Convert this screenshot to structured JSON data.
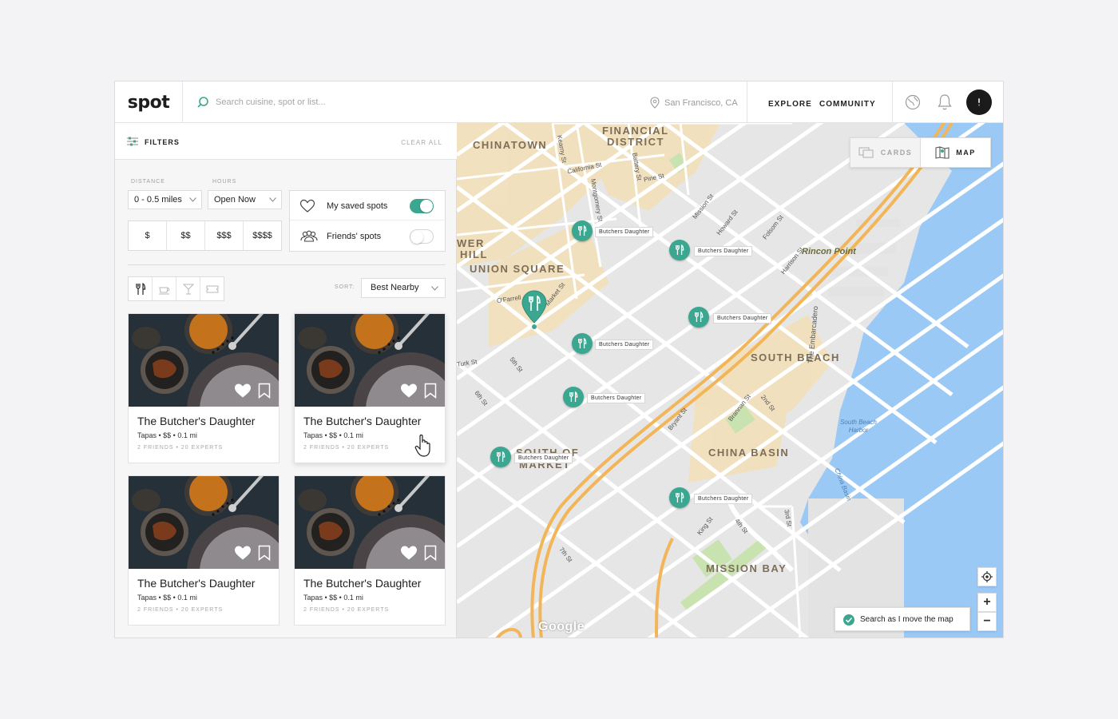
{
  "app": {
    "logo": "spot"
  },
  "header": {
    "search_placeholder": "Search cuisine, spot or list...",
    "location": "San Francisco, CA",
    "nav": [
      "EXPLORE",
      "COMMUNITY"
    ]
  },
  "filters": {
    "title": "FILTERS",
    "clear_all": "CLEAR ALL",
    "distance_label": "DISTANCE",
    "distance_value": "0 - 0.5 miles",
    "hours_label": "HOURS",
    "hours_value": "Open Now",
    "prices": [
      "$",
      "$$",
      "$$$",
      "$$$$"
    ],
    "saved_spots": {
      "label": "My saved spots",
      "on": true
    },
    "friends_spots": {
      "label": "Friends' spots",
      "on": false
    },
    "categories": [
      "restaurant-icon",
      "coffee-icon",
      "bar-icon",
      "ticket-icon"
    ],
    "sort_label": "SORT:",
    "sort_value": "Best Nearby"
  },
  "cards": [
    {
      "title": "The Butcher's Daughter",
      "meta": "Tapas • $$  • 0.1 mi",
      "social": "2 FRIENDS • 20 EXPERTS"
    },
    {
      "title": "The Butcher's Daughter",
      "meta": "Tapas • $$  • 0.1 mi",
      "social": "2 FRIENDS • 20 EXPERTS"
    },
    {
      "title": "The Butcher's Daughter",
      "meta": "Tapas • $$  • 0.1 mi",
      "social": "2 FRIENDS • 20 EXPERTS"
    },
    {
      "title": "The Butcher's Daughter",
      "meta": "Tapas • $$  • 0.1 mi",
      "social": "2 FRIENDS • 20 EXPERTS"
    }
  ],
  "map": {
    "view_cards": "CARDS",
    "view_map": "MAP",
    "pin_label": "Butchers Daughter",
    "areas": [
      "CHINATOWN",
      "FINANCIAL",
      "DISTRICT",
      "UNION SQUARE",
      "WER",
      "HILL",
      "SOUTH BEACH",
      "CHINA BASIN",
      "MISSION BAY",
      "SOUTH OF",
      "MARKET"
    ],
    "streets": [
      "Kearny St",
      "California St",
      "Battery St",
      "Pine St",
      "Mission St",
      "Howard St",
      "Folsom St",
      "Harrison St",
      "Market St",
      "Turk St",
      "5th St",
      "6th St",
      "4th St",
      "3rd St",
      "2nd St",
      "Bryant St",
      "Brannan St",
      "King St",
      "7th St",
      "Bryant St",
      "The Embarcadero",
      "South Beach Harbor",
      "China Basin",
      "Rincon Point",
      "O'Farrell",
      "Montgomery St"
    ],
    "search_as_move": "Search as I move the map",
    "attribution": "Google",
    "zoom_in": "+",
    "zoom_out": "−"
  },
  "colors": {
    "accent": "#3ca790",
    "water": "#9bc9f5",
    "highway": "#f2b558",
    "park": "#c8e3b0",
    "district": "#f5dfb4"
  }
}
